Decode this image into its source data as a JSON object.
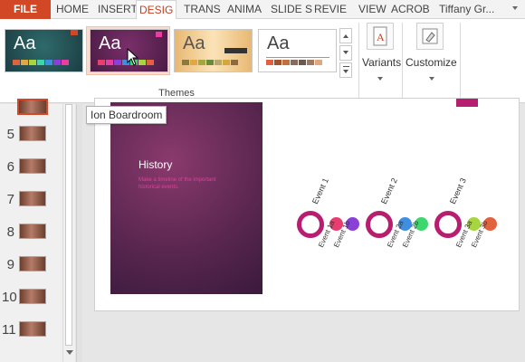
{
  "tabs": [
    {
      "label": "FILE"
    },
    {
      "label": "HOME"
    },
    {
      "label": "INSERT"
    },
    {
      "label": "DESIG"
    },
    {
      "label": "TRANS"
    },
    {
      "label": "ANIMA"
    },
    {
      "label": "SLIDE S"
    },
    {
      "label": "REVIE"
    },
    {
      "label": "VIEW"
    },
    {
      "label": "ACROB"
    }
  ],
  "user": {
    "name": "Tiffany Gr..."
  },
  "ribbon": {
    "themes_group_label": "Themes",
    "theme_preview_text": "Aa",
    "variants_label": "Variants",
    "customize_label": "Customize"
  },
  "tooltip": {
    "text": "Ion Boardroom"
  },
  "slides_pane": {
    "numbers": [
      "5",
      "6",
      "7",
      "8",
      "9",
      "10",
      "11"
    ]
  },
  "slide": {
    "title": "History",
    "subtitle": "Make a timeline of the important historical events.",
    "events": [
      {
        "label": "Event 1",
        "subs": [
          "Event 1a",
          "Event 1b"
        ]
      },
      {
        "label": "Event 2",
        "subs": [
          "Event 2a",
          "Event 2b"
        ]
      },
      {
        "label": "Event 3",
        "subs": [
          "Event 3a",
          "Event 3b"
        ]
      }
    ]
  },
  "colors": {
    "file_tab": "#d24726",
    "accent": "#b81e6f",
    "dot_pink": "#e83e6f",
    "dot_purple": "#8a3fd6",
    "dot_blue": "#3f8ee0",
    "dot_green": "#3ed66f",
    "dot_lime": "#a6d63e",
    "dot_orange": "#e0623e"
  }
}
